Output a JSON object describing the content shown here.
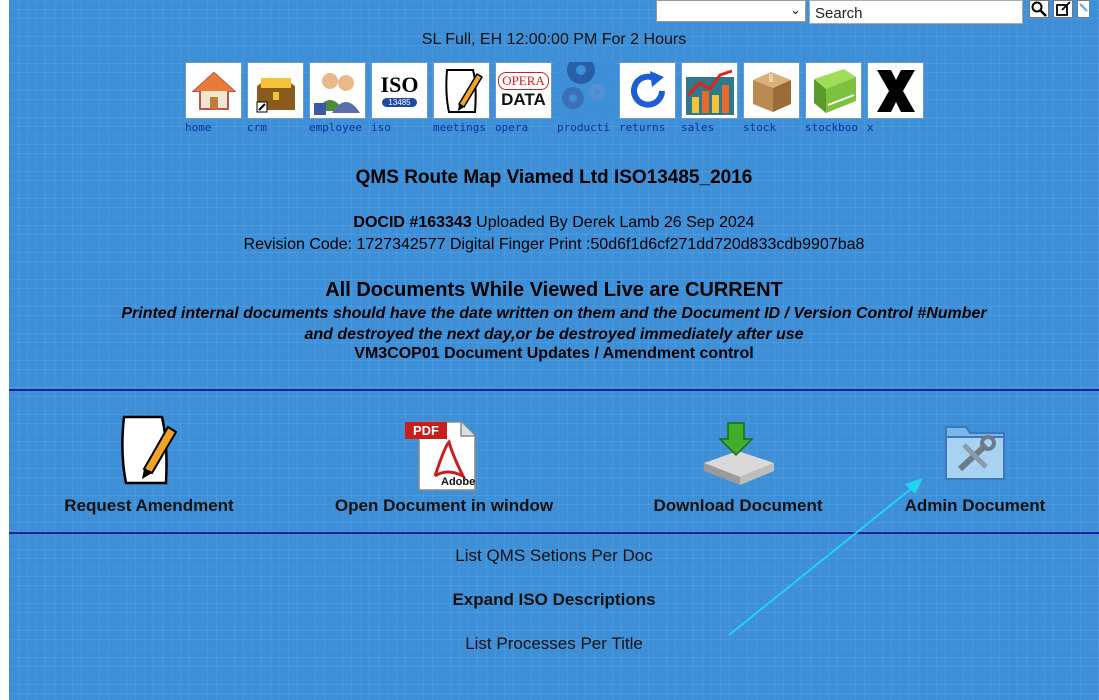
{
  "topbar": {
    "search_placeholder": "Search",
    "select_chevron": "⌄"
  },
  "status_text": "SL Full, EH 12:00:00 PM For 2 Hours",
  "nav_icons": [
    {
      "label": "home",
      "icon": "house-icon"
    },
    {
      "label": "crm",
      "icon": "treasure-chest-icon"
    },
    {
      "label": "employee",
      "icon": "people-icon"
    },
    {
      "label": "iso",
      "icon": "iso-icon"
    },
    {
      "label": "meetings",
      "icon": "notepad-icon"
    },
    {
      "label": "opera",
      "icon": "opera-data-icon"
    },
    {
      "label": "producti",
      "icon": "gears-icon"
    },
    {
      "label": "returns",
      "icon": "refresh-icon"
    },
    {
      "label": "sales",
      "icon": "chart-icon"
    },
    {
      "label": "stock",
      "icon": "box-icon"
    },
    {
      "label": "stockboo",
      "icon": "book-icon"
    },
    {
      "label": "x",
      "icon": "x-icon"
    }
  ],
  "iso_icon_text": {
    "big": "ISO",
    "small": "13485"
  },
  "opera_icon_text": {
    "top": "OPERA",
    "bottom": "DATA"
  },
  "pdf_icon_text": {
    "top": "PDF",
    "bottom": "Adobe"
  },
  "doc_title": "QMS Route Map Viamed Ltd ISO13485_2016",
  "docid_label": "DOCID #163343",
  "docid_rest": "Uploaded By Derek Lamb 26 Sep 2024",
  "revision_line": "Revision Code: 1727342577 Digital Finger Print :50d6f1d6cf271dd720d833cdb9907ba8",
  "all_docs_heading": "All Documents While Viewed Live are CURRENT",
  "notice_line1": "Printed internal documents should have the date written on them and the Document ID / Version Control #Number",
  "notice_line2": "and destroyed the next day,or be destroyed immediately after use",
  "vm_line": "VM3COP01 Document Updates / Amendment control",
  "actions": [
    {
      "label": "Request Amendment",
      "icon": "notepad-pencil-icon"
    },
    {
      "label": "Open Document in window",
      "icon": "pdf-icon"
    },
    {
      "label": "Download Document",
      "icon": "download-drive-icon"
    },
    {
      "label": "Admin Document",
      "icon": "tools-folder-icon"
    }
  ],
  "links": [
    {
      "label": "List QMS Setions Per Doc",
      "bold": false
    },
    {
      "label": "Expand ISO Descriptions",
      "bold": true
    },
    {
      "label": "List Processes Per Title",
      "bold": false
    }
  ],
  "colors": {
    "background": "#3d8fd8",
    "divider": "#1c1f9e",
    "nav_label": "#0c2f9e",
    "annotation_arrow": "#22d3f0"
  }
}
